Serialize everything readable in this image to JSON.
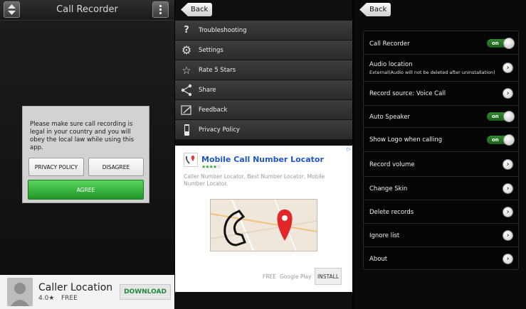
{
  "panel1": {
    "title": "Call Recorder",
    "dialog": {
      "message": "Please make sure call recording is legal in your country and you will obey the local law while using this app.",
      "privacy_label": "PRIVACY POLICY",
      "disagree_label": "DISAGREE",
      "agree_label": "AGREE"
    },
    "ad": {
      "app_name": "Caller Location",
      "rating": "4.0★",
      "price": "FREE",
      "download_label": "DOWNLOAD"
    }
  },
  "panel2": {
    "back_label": "Back",
    "menu": [
      {
        "icon": "question-icon",
        "label": "Troubleshooting"
      },
      {
        "icon": "gear-icon",
        "label": "Settings"
      },
      {
        "icon": "star-icon",
        "label": "Rate 5 Stars"
      },
      {
        "icon": "share-icon",
        "label": "Share"
      },
      {
        "icon": "feedback-icon",
        "label": "Feedback"
      },
      {
        "icon": "phone-icon",
        "label": "Privacy Policy"
      }
    ],
    "ad": {
      "app_name": "Mobile Call Number Locator",
      "stars": "★★★★☆",
      "description": "Caller Number Locator, Best Number Locator, Mobile Number Locator.",
      "price": "FREE",
      "store": "Google Play",
      "install_label": "INSTALL"
    }
  },
  "panel3": {
    "back_label": "Back",
    "toggle_on_text": "on",
    "settings": [
      {
        "label": "Call Recorder",
        "control": "toggle"
      },
      {
        "label": "Audio location",
        "sub": "External(Audio will not be deleted after uninstallation)",
        "control": "arrow"
      },
      {
        "label": "Record source: Voice Call",
        "control": "arrow"
      },
      {
        "label": "Auto Speaker",
        "control": "toggle"
      },
      {
        "label": "Show Logo when calling",
        "control": "toggle"
      },
      {
        "label": "Record volume",
        "control": "arrow"
      },
      {
        "label": "Change Skin",
        "control": "arrow"
      },
      {
        "label": "Delete records",
        "control": "arrow"
      },
      {
        "label": "Ignore list",
        "control": "arrow"
      },
      {
        "label": "About",
        "control": "arrow"
      }
    ]
  },
  "colors": {
    "agree_green": "#2aa635",
    "toggle_green": "#2f8a2f",
    "ad_title_blue": "#1e56c6",
    "download_green": "#1e8a3a"
  }
}
